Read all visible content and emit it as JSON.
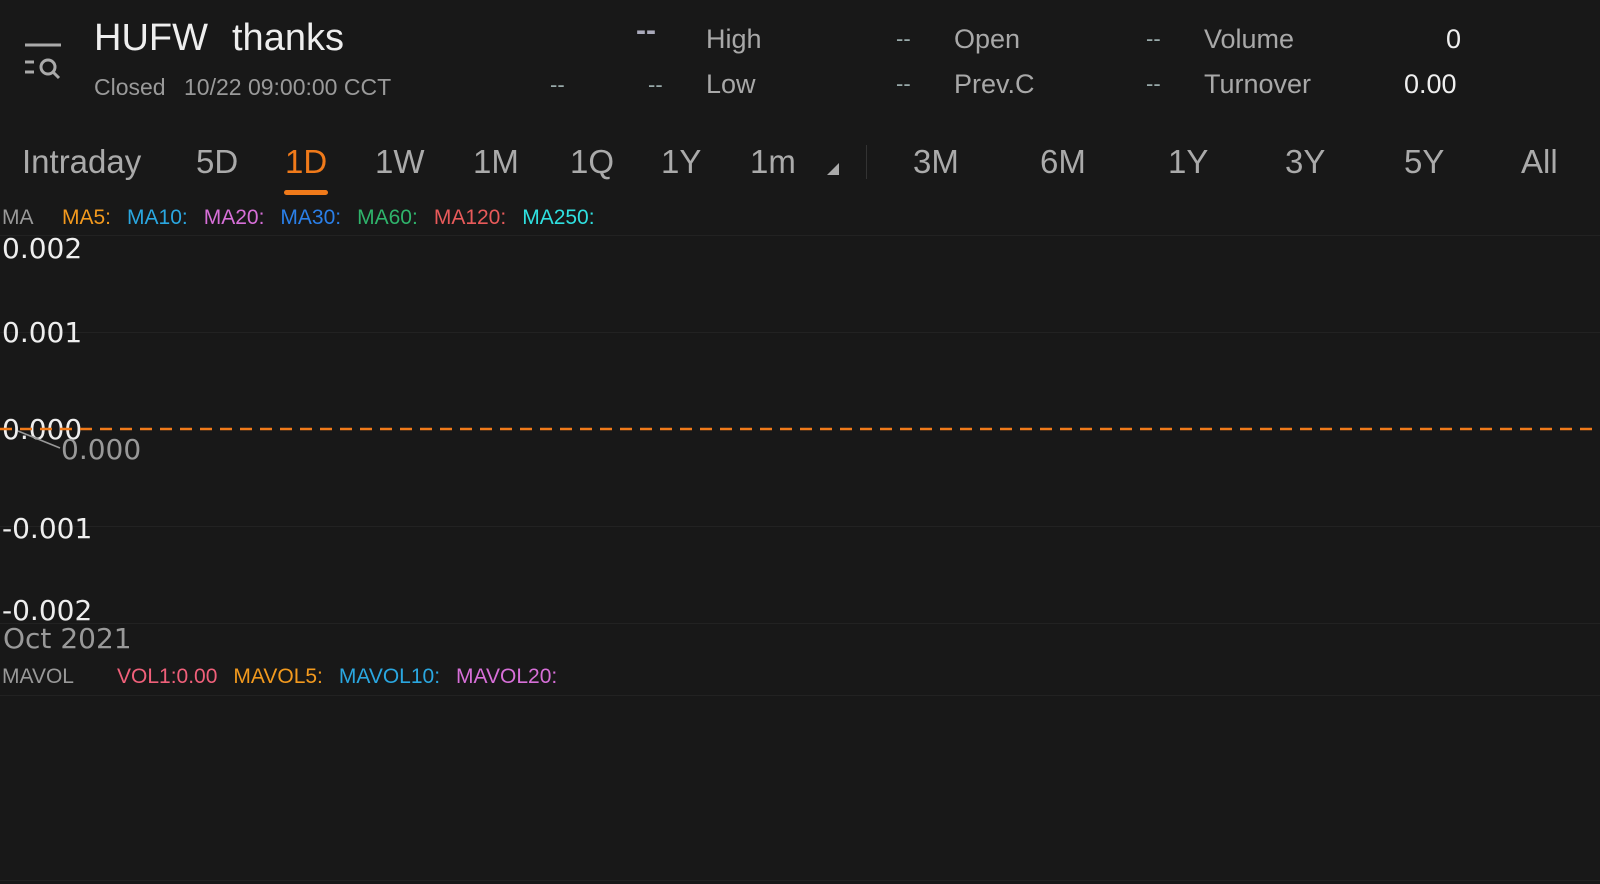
{
  "header": {
    "symbol": "HUFW",
    "name": "thanks",
    "status": "Closed",
    "datetime": "10/22 09:00:00 CCT",
    "price": "--",
    "change": "--",
    "change_pct": "--",
    "stats": [
      {
        "label": "High",
        "value": "--"
      },
      {
        "label": "Open",
        "value": "--"
      },
      {
        "label": "Volume",
        "value": "0"
      },
      {
        "label": "Low",
        "value": "--"
      },
      {
        "label": "Prev.C",
        "value": "--"
      },
      {
        "label": "Turnover",
        "value": "0.00"
      }
    ]
  },
  "tabs": [
    "Intraday",
    "5D",
    "1D",
    "1W",
    "1M",
    "1Q",
    "1Y",
    "1m",
    "3M",
    "6M",
    "1Y",
    "3Y",
    "5Y",
    "All"
  ],
  "active_tab": "1D",
  "ma_legend": {
    "title": "MA",
    "items": [
      {
        "label": "MA5:",
        "color": "#f39a1e"
      },
      {
        "label": "MA10:",
        "color": "#2aa7e0"
      },
      {
        "label": "MA20:",
        "color": "#d76fd8"
      },
      {
        "label": "MA30:",
        "color": "#2a7fe8"
      },
      {
        "label": "MA60:",
        "color": "#2fb36b"
      },
      {
        "label": "MA120:",
        "color": "#e85a5a"
      },
      {
        "label": "MA250:",
        "color": "#2fe0e0"
      }
    ]
  },
  "chart_data": {
    "type": "line",
    "yticks": [
      "0.002",
      "0.001",
      "0.000",
      "-0.001",
      "-0.002"
    ],
    "ylim": [
      -0.002,
      0.002
    ],
    "xticks": [
      "Oct 2021"
    ],
    "reference_line": {
      "value": 0,
      "label": "0.000",
      "color": "#f07a1a"
    }
  },
  "vol_legend": {
    "title": "MAVOL",
    "items": [
      {
        "label": "VOL1:0.00",
        "color": "#f0607a"
      },
      {
        "label": "MAVOL5:",
        "color": "#f39a1e"
      },
      {
        "label": "MAVOL10:",
        "color": "#2aa7e0"
      },
      {
        "label": "MAVOL20:",
        "color": "#d76fd8"
      }
    ]
  }
}
